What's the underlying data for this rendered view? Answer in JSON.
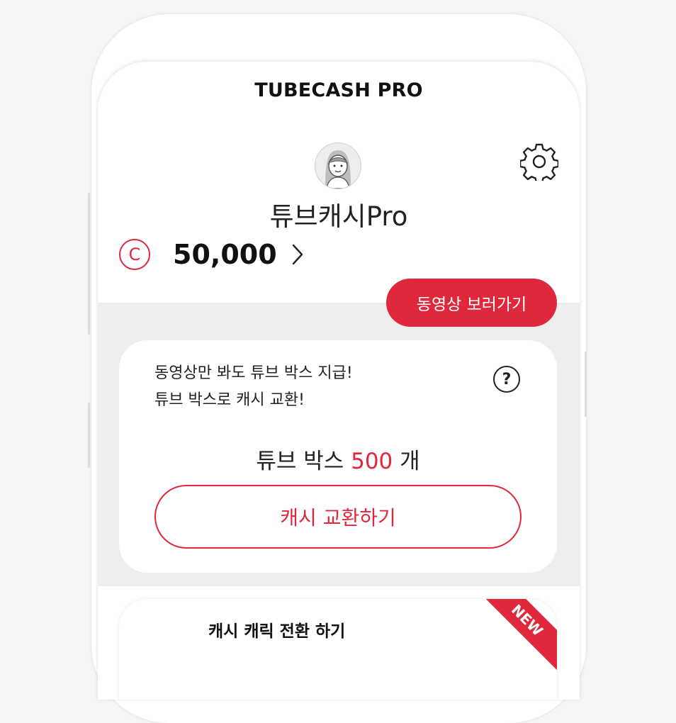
{
  "header": {
    "title": "TUBECASH PRO"
  },
  "profile": {
    "name": "튜브캐시Pro",
    "balance_symbol": "C",
    "balance": "50,000"
  },
  "actions": {
    "watch_videos": "동영상 보러가기"
  },
  "box_card": {
    "line1": "동영상만 봐도 튜브 박스 지급!",
    "line2": "튜브 박스로 캐시 교환!",
    "help_symbol": "?",
    "count_prefix": "튜브 박스",
    "count": "500",
    "count_suffix": "개",
    "exchange_label": "캐시 교환하기"
  },
  "bottom_card": {
    "title": "캐시 캐릭 전환 하기",
    "badge": "NEW"
  },
  "colors": {
    "accent": "#e0283c",
    "background": "#eeeeee",
    "text": "#222222"
  },
  "icons": {
    "settings": "gear-icon",
    "balance": "coin-icon",
    "more": "chevron-right-icon",
    "help": "question-icon"
  }
}
